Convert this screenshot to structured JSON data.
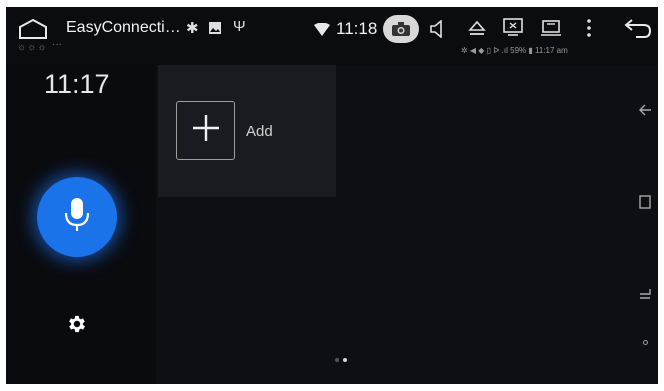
{
  "status_bar": {
    "app_title": "EasyConnecti…",
    "time": "11:18",
    "sub_indicators": "☼☼☼",
    "sub_ellipsis": "···",
    "sub_status": "✲ ◀ ◆ ▯ ᐅ .ıl 59% ▮ 11:17 am"
  },
  "clock": {
    "time": "11:17"
  },
  "tile": {
    "add_label": "Add"
  },
  "icons": {
    "home": "home-icon",
    "bluetooth": "bluetooth-icon",
    "image": "image-icon",
    "usb": "usb-icon",
    "wifi": "wifi-icon",
    "camera": "camera-icon",
    "volume": "volume-icon",
    "eject": "eject-icon",
    "screenshot": "screenshot-icon",
    "recents": "recents-icon",
    "menu": "menu-icon",
    "back": "back-icon",
    "microphone": "microphone-icon",
    "settings": "gear-icon",
    "plus": "plus-icon"
  },
  "pager": {
    "pages": 2,
    "active": 2
  },
  "colors": {
    "background": "#0d0f14",
    "mic_button": "#1a73e8",
    "tile": "#1a1b21"
  }
}
